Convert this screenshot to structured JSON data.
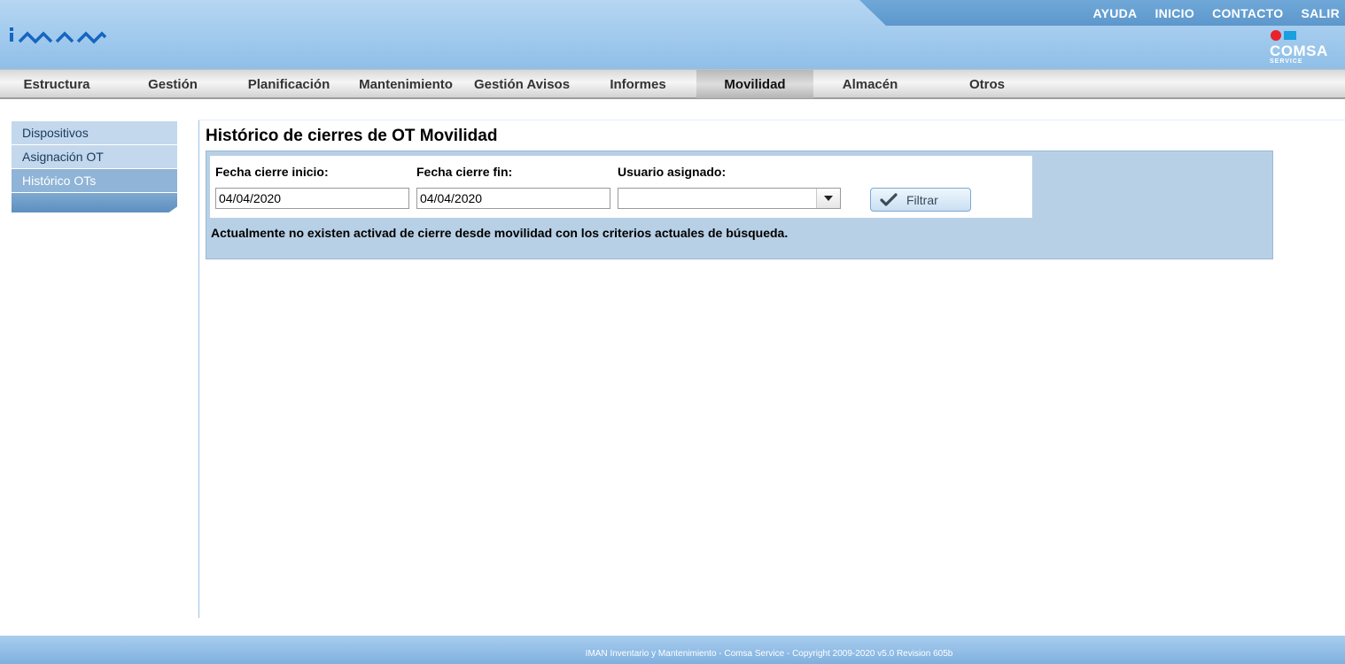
{
  "header": {
    "top_links": [
      "AYUDA",
      "INICIO",
      "CONTACTO",
      "SALIR"
    ],
    "logo_text": "IMAN",
    "brand_logo": {
      "name": "COMSA",
      "sub": "SERVICE"
    }
  },
  "menu": {
    "items": [
      "Estructura",
      "Gestión",
      "Planificación",
      "Mantenimiento",
      "Gestión Avisos",
      "Informes",
      "Movilidad",
      "Almacén",
      "Otros"
    ],
    "active": "Movilidad"
  },
  "sidebar": {
    "items": [
      "Dispositivos",
      "Asignación OT",
      "Histórico OTs"
    ],
    "active": "Histórico OTs"
  },
  "main": {
    "title": "Histórico de cierres de OT Movilidad",
    "filters": {
      "start_label": "Fecha cierre inicio:",
      "start_value": "04/04/2020",
      "end_label": "Fecha cierre fin:",
      "end_value": "04/04/2020",
      "user_label": "Usuario asignado:",
      "user_value": "",
      "button_label": "Filtrar"
    },
    "message": "Actualmente no existen activad de cierre desde movilidad con los criterios actuales de búsqueda."
  },
  "footer": {
    "text": "IMAN Inventario y Mantenimiento - Comsa Service - Copyright 2009-2020 v5.0 Revision 605b"
  },
  "colors": {
    "header": "#8fbfe8",
    "panel": "#b8d0e6",
    "sidebar_active": "#8fb4d7",
    "brand_red": "#e8232b",
    "brand_blue": "#1a9fe0"
  },
  "icons": [
    "check-icon",
    "chevron-down-icon"
  ]
}
